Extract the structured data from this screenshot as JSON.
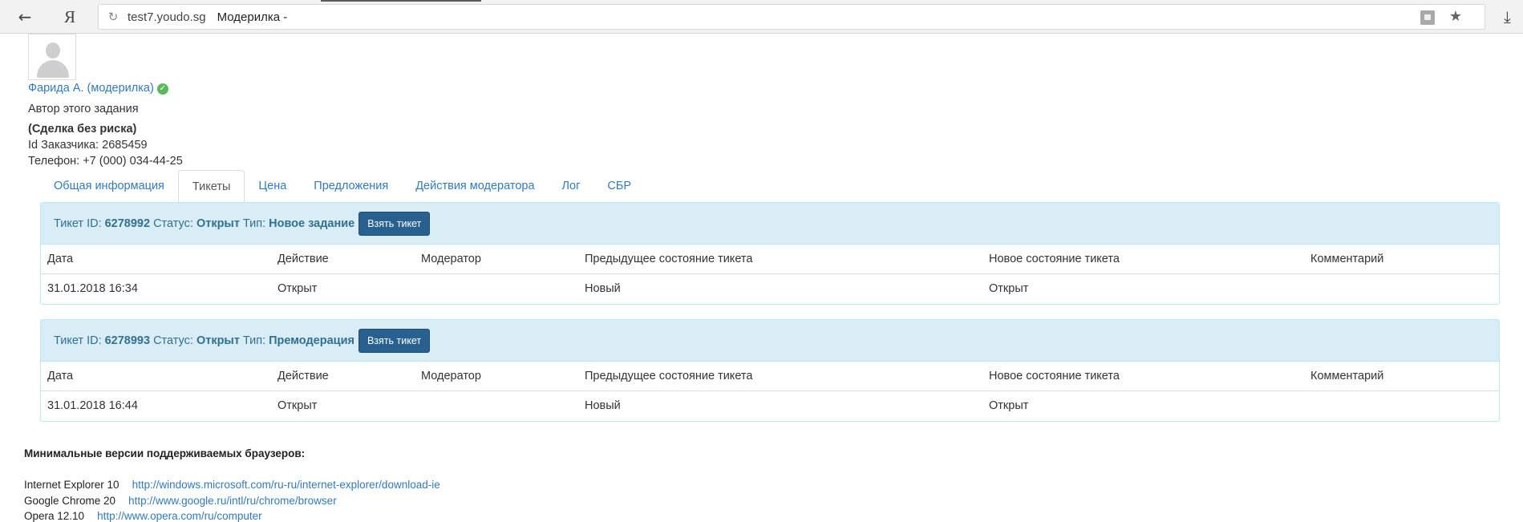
{
  "browser": {
    "host": "test7.youdo.sg",
    "title": "Модерилка -",
    "yandex_glyph": "Я"
  },
  "profile": {
    "name": "Фарида А. (модерилка)",
    "role": "Автор этого задания",
    "deal": "(Сделка без риска)",
    "customer_id_label": "Id Заказчика:",
    "customer_id": "2685459",
    "phone_label": "Телефон:",
    "phone": "+7 (000) 034-44-25"
  },
  "tabs": [
    "Общая информация",
    "Тикеты",
    "Цена",
    "Предложения",
    "Действия модератора",
    "Лог",
    "СБР"
  ],
  "ticket_labels": {
    "id": "Тикет ID:",
    "status": "Статус:",
    "type": "Тип:",
    "take_button": "Взять тикет"
  },
  "columns": [
    "Дата",
    "Действие",
    "Модератор",
    "Предыдущее состояние тикета",
    "Новое состояние тикета",
    "Комментарий"
  ],
  "tickets": [
    {
      "id": "6278992",
      "status": "Открыт",
      "type": "Новое задание",
      "rows": [
        {
          "date": "31.01.2018 16:34",
          "action": "Открыт",
          "moderator": "",
          "prev": "Новый",
          "new": "Открыт",
          "comment": ""
        }
      ]
    },
    {
      "id": "6278993",
      "status": "Открыт",
      "type": "Премодерация",
      "rows": [
        {
          "date": "31.01.2018 16:44",
          "action": "Открыт",
          "moderator": "",
          "prev": "Новый",
          "new": "Открыт",
          "comment": ""
        }
      ]
    }
  ],
  "footer": {
    "heading": "Минимальные версии поддерживаемых браузеров:",
    "browsers": [
      {
        "name": "Internet Explorer 10",
        "url": "http://windows.microsoft.com/ru-ru/internet-explorer/download-ie"
      },
      {
        "name": "Google Chrome 20",
        "url": "http://www.google.ru/intl/ru/chrome/browser"
      },
      {
        "name": "Opera 12.10",
        "url": "http://www.opera.com/ru/computer"
      }
    ]
  },
  "colors": {
    "link": "#337ab7",
    "panel_bg": "#d9edf7",
    "panel_border": "#bce8f1",
    "button": "#286090",
    "verified": "#5cb85c"
  }
}
